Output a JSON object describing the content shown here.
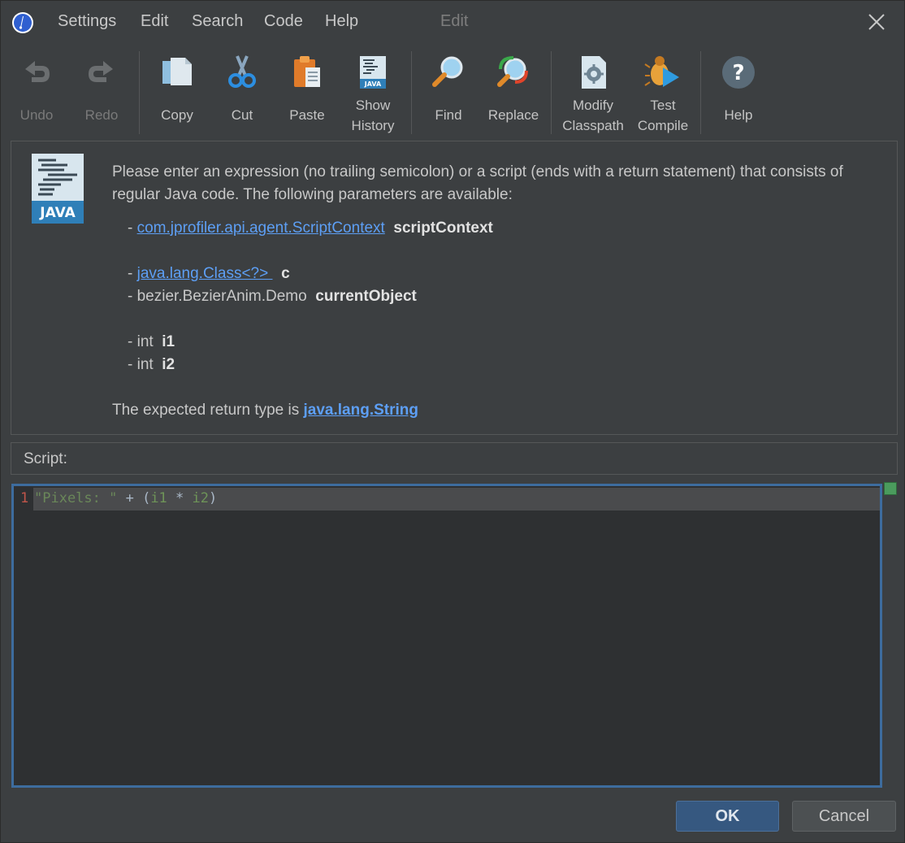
{
  "menu": {
    "items": [
      "Settings",
      "Edit",
      "Search",
      "Code",
      "Help"
    ],
    "title": "Edit"
  },
  "toolbar": {
    "undo": "Undo",
    "redo": "Redo",
    "copy": "Copy",
    "cut": "Cut",
    "paste": "Paste",
    "show_history_1": "Show",
    "show_history_2": "History",
    "find": "Find",
    "replace": "Replace",
    "modify_classpath_1": "Modify",
    "modify_classpath_2": "Classpath",
    "test_compile_1": "Test",
    "test_compile_2": "Compile",
    "help": "Help"
  },
  "info": {
    "description": "Please enter an expression (no trailing semicolon) or a script (ends with a return statement) that consists of regular Java code. The following parameters are available:",
    "java_badge": "JAVA",
    "params": [
      {
        "type": "com.jprofiler.api.agent.ScriptContext",
        "name": "scriptContext",
        "link": true
      },
      {
        "type": "java.lang.Class<?> ",
        "name": "c",
        "link": true
      },
      {
        "type": "bezier.BezierAnim.Demo",
        "name": "currentObject",
        "link": false
      },
      {
        "type": "int",
        "name": "i1",
        "link": false
      },
      {
        "type": "int",
        "name": "i2",
        "link": false
      }
    ],
    "return_prefix": "The expected return type is ",
    "return_type": "java.lang.String"
  },
  "script": {
    "label": "Script:",
    "line_number": "1",
    "tokens": {
      "str": "\"Pixels: \"",
      "op1": " + (",
      "v1": "i1",
      "op2": " * ",
      "v2": "i2",
      "op3": ")"
    }
  },
  "buttons": {
    "ok": "OK",
    "cancel": "Cancel"
  },
  "colors": {
    "background": "#3c3f41",
    "editor_border": "#3d6c9e",
    "link": "#5d9ff5",
    "ok_button": "#365880"
  }
}
